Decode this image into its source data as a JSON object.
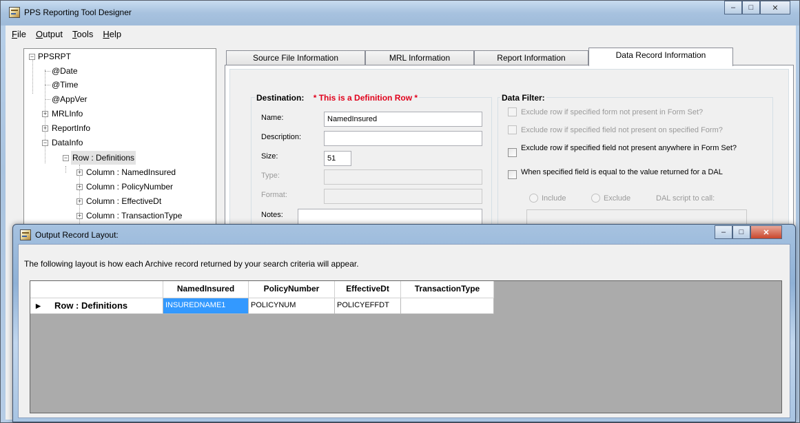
{
  "main_window": {
    "title": "PPS Reporting Tool Designer",
    "menu": [
      {
        "label": "File",
        "accel": "F",
        "rest": "ile"
      },
      {
        "label": "Output",
        "accel": "O",
        "rest": "utput"
      },
      {
        "label": "Tools",
        "accel": "T",
        "rest": "ools"
      },
      {
        "label": "Help",
        "accel": "H",
        "rest": "elp"
      }
    ]
  },
  "tree": {
    "root": "PPSRPT",
    "items": [
      "@Date",
      "@Time",
      "@AppVer",
      "MRLInfo",
      "ReportInfo",
      "DataInfo",
      "Row : Definitions",
      "Column : NamedInsured",
      "Column : PolicyNumber",
      "Column : EffectiveDt",
      "Column : TransactionType"
    ]
  },
  "tabs": [
    "Source File Information",
    "MRL Information",
    "Report Information",
    "Data Record Information"
  ],
  "destination": {
    "title": "Destination:",
    "definition_note": "* This is a Definition Row *",
    "name_label": "Name:",
    "name_value": "NamedInsured",
    "description_label": "Description:",
    "description_value": "",
    "size_label": "Size:",
    "size_value": "51",
    "type_label": "Type:",
    "format_label": "Format:",
    "notes_label": "Notes:"
  },
  "data_filter": {
    "title": "Data Filter:",
    "options": [
      "Exclude row if specified form not present in Form Set?",
      "Exclude row if specified field not present on specified Form?",
      "Exclude row if specified field not present anywhere in Form Set?",
      "When specified field is equal to the value returned for a DAL"
    ],
    "include_label": "Include",
    "exclude_label": "Exclude",
    "dal_label": "DAL script to call:"
  },
  "dialog": {
    "title": "Output Record Layout:",
    "intro": "The following layout is how each Archive record returned by your search criteria will appear.",
    "columns": [
      "NamedInsured",
      "PolicyNumber",
      "EffectiveDt",
      "TransactionType"
    ],
    "row_header": "Row : Definitions",
    "row_values": [
      "INSUREDNAME1",
      "POLICYNUM",
      "POLICYEFFDT",
      ""
    ]
  },
  "colors": {
    "accent_selection": "#3399ff",
    "required_text": "#e0001b",
    "close_button": "#c9472c"
  }
}
